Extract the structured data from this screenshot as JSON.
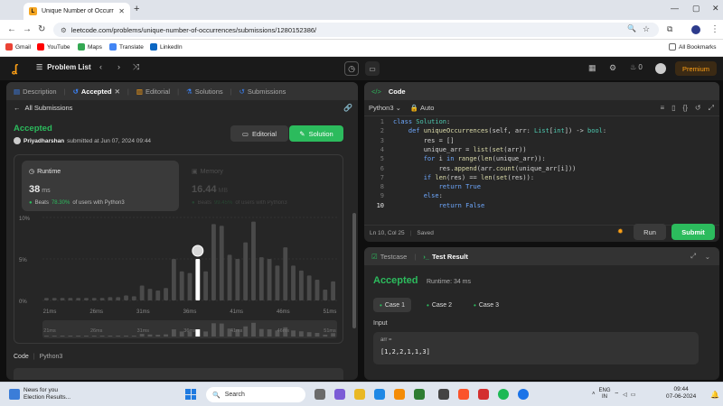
{
  "browser": {
    "tab_title": "Unique Number of Occurrence",
    "url": "leetcode.com/problems/unique-number-of-occurrences/submissions/1280152386/",
    "bookmarks": [
      "Gmail",
      "YouTube",
      "Maps",
      "Translate",
      "LinkedIn"
    ],
    "all_bookmarks": "All Bookmarks"
  },
  "nav": {
    "problem_list": "Problem List",
    "streak": "0",
    "premium": "Premium"
  },
  "left_tabs": [
    "Description",
    "Accepted",
    "Editorial",
    "Solutions",
    "Submissions"
  ],
  "submission": {
    "back_label": "All Submissions",
    "status": "Accepted",
    "user": "Priyadharshan",
    "submitted_text": "submitted at Jun 07, 2024 09:44",
    "editorial_btn": "Editorial",
    "solution_btn": "Solution",
    "runtime": {
      "label": "Runtime",
      "value": "38",
      "unit": "ms",
      "beats_label": "Beats",
      "beats_pct": "78.30%",
      "beats_suffix": "of users with Python3"
    },
    "memory": {
      "label": "Memory",
      "value": "16.44",
      "unit": "MB",
      "beats_label": "Beats",
      "beats_pct": "99.45%",
      "beats_suffix": "of users with Python3"
    },
    "footer_code": "Code",
    "footer_lang": "Python3"
  },
  "chart_data": {
    "type": "bar",
    "yticks": [
      "10%",
      "5%",
      "0%"
    ],
    "ylim": [
      0,
      10
    ],
    "xticks": [
      "21ms",
      "26ms",
      "31ms",
      "36ms",
      "41ms",
      "46ms",
      "51ms"
    ],
    "values": [
      0.3,
      0.3,
      0.3,
      0.3,
      0.3,
      0.3,
      0.3,
      0.3,
      0.4,
      0.4,
      0.6,
      0.5,
      1.8,
      1.4,
      1.2,
      1.5,
      5.0,
      3.5,
      3.3,
      5.0,
      3.5,
      9.2,
      9.0,
      5.5,
      5.0,
      7.0,
      9.5,
      5.2,
      5.0,
      4.2,
      6.4,
      4.2,
      3.6,
      3.0,
      2.5,
      1.3,
      2.3
    ],
    "highlight_index": 19
  },
  "code_panel": {
    "title": "Code",
    "language": "Python3",
    "auto": "Auto",
    "lines": [
      "class Solution:",
      "    def uniqueOccurrences(self, arr: List[int]) -> bool:",
      "        res = []",
      "        unique_arr = list(set(arr))",
      "        for i in range(len(unique_arr)):",
      "            res.append(arr.count(unique_arr[i]))",
      "        if len(res) == len(set(res)):",
      "            return True",
      "        else:",
      "            return False"
    ],
    "status": "Ln 10, Col 25",
    "saved": "Saved",
    "run": "Run",
    "submit": "Submit"
  },
  "test": {
    "tab_testcase": "Testcase",
    "tab_result": "Test Result",
    "status": "Accepted",
    "runtime": "Runtime: 34 ms",
    "cases": [
      "Case 1",
      "Case 2",
      "Case 3"
    ],
    "input_label": "Input",
    "var": "arr =",
    "value": "[1,2,2,1,1,3]"
  },
  "taskbar": {
    "news_title": "News for you",
    "news_sub": "Election Results...",
    "search": "Search",
    "lang1": "ENG",
    "lang2": "IN",
    "time": "09:44",
    "date": "07-06-2024"
  },
  "colors": {
    "accent_green": "#2cbb5d",
    "accent_orange": "#ffa116"
  }
}
